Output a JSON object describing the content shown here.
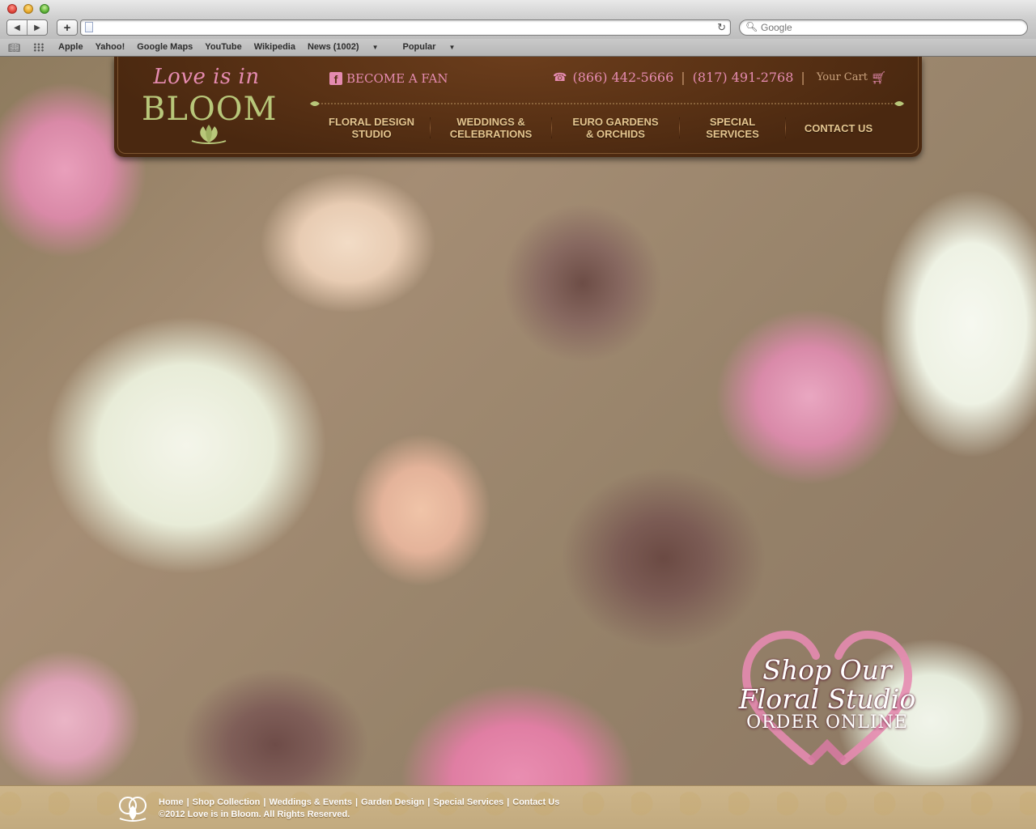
{
  "browser": {
    "search_placeholder": "Google",
    "bookmarks": [
      "Apple",
      "Yahoo!",
      "Google Maps",
      "YouTube",
      "Wikipedia",
      "News (1002)",
      "Popular"
    ]
  },
  "header": {
    "logo_script": "Love is in",
    "logo_main": "BLOOM",
    "become_fan": "BECOME A FAN",
    "phone_primary": "(866) 442-5666",
    "phone_secondary": "(817) 491-2768",
    "cart_label": "Your Cart",
    "accent_color": "#e58bb0",
    "brown_color": "#5a3215"
  },
  "nav": [
    {
      "line1": "FLORAL DESIGN",
      "line2": "STUDIO"
    },
    {
      "line1": "WEDDINGS &",
      "line2": "CELEBRATIONS"
    },
    {
      "line1": "EURO GARDENS",
      "line2": "& ORCHIDS"
    },
    {
      "line1": "SPECIAL",
      "line2": "SERVICES"
    },
    {
      "line1": "CONTACT US",
      "line2": ""
    }
  ],
  "cta": {
    "line1": "Shop Our",
    "line2": "Floral Studio",
    "line3": "ORDER ONLINE"
  },
  "footer": {
    "links": [
      "Home",
      "Shop Collection",
      "Weddings & Events",
      "Garden Design",
      "Special Services",
      "Contact Us"
    ],
    "copyright": "©2012 Love is in Bloom. All Rights Reserved."
  }
}
